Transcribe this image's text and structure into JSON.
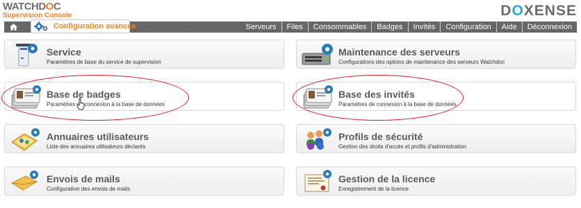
{
  "header": {
    "logo_main_a": "WATCHD",
    "logo_main_o": "O",
    "logo_main_b": "C",
    "logo_sub": "Supervision Console",
    "brand_a": "D",
    "brand_x": "O",
    "brand_b": "XENSE"
  },
  "nav": {
    "active_label": "Configuration avancée",
    "items": [
      "Serveurs",
      "Files",
      "Consommables",
      "Badges",
      "Invités",
      "Configuration",
      "Aide",
      "Déconnexion"
    ]
  },
  "cards": [
    {
      "title": "Service",
      "desc": "Paramètres de base du service de supervision",
      "icon": "service-icon"
    },
    {
      "title": "Maintenance des serveurs",
      "desc": "Configurations des options de maintenance des serveurs Watchdoc",
      "icon": "server-maintenance-icon"
    },
    {
      "title": "Base de badges",
      "desc": "Paramètres de connexion à la base de données",
      "icon": "badge-cards-icon"
    },
    {
      "title": "Base des invités",
      "desc": "Paramètres de connexion à la base de données",
      "icon": "guest-cards-icon"
    },
    {
      "title": "Annuaires utilisateurs",
      "desc": "Liste des annuaires utilisateurs déclarés",
      "icon": "directory-icon"
    },
    {
      "title": "Profils de sécurité",
      "desc": "Gestion des droits d'accès et profils d'administration",
      "icon": "security-profiles-icon"
    },
    {
      "title": "Envois de mails",
      "desc": "Configuration des envois de mails",
      "icon": "mail-icon"
    },
    {
      "title": "Gestion de la licence",
      "desc": "Enregistrement de la licence",
      "icon": "license-icon"
    }
  ],
  "colors": {
    "accent_orange": "#e8842a",
    "navbar_grey": "#666666",
    "highlight_red": "#e0141b",
    "gear_blue": "#2a7bb8"
  }
}
